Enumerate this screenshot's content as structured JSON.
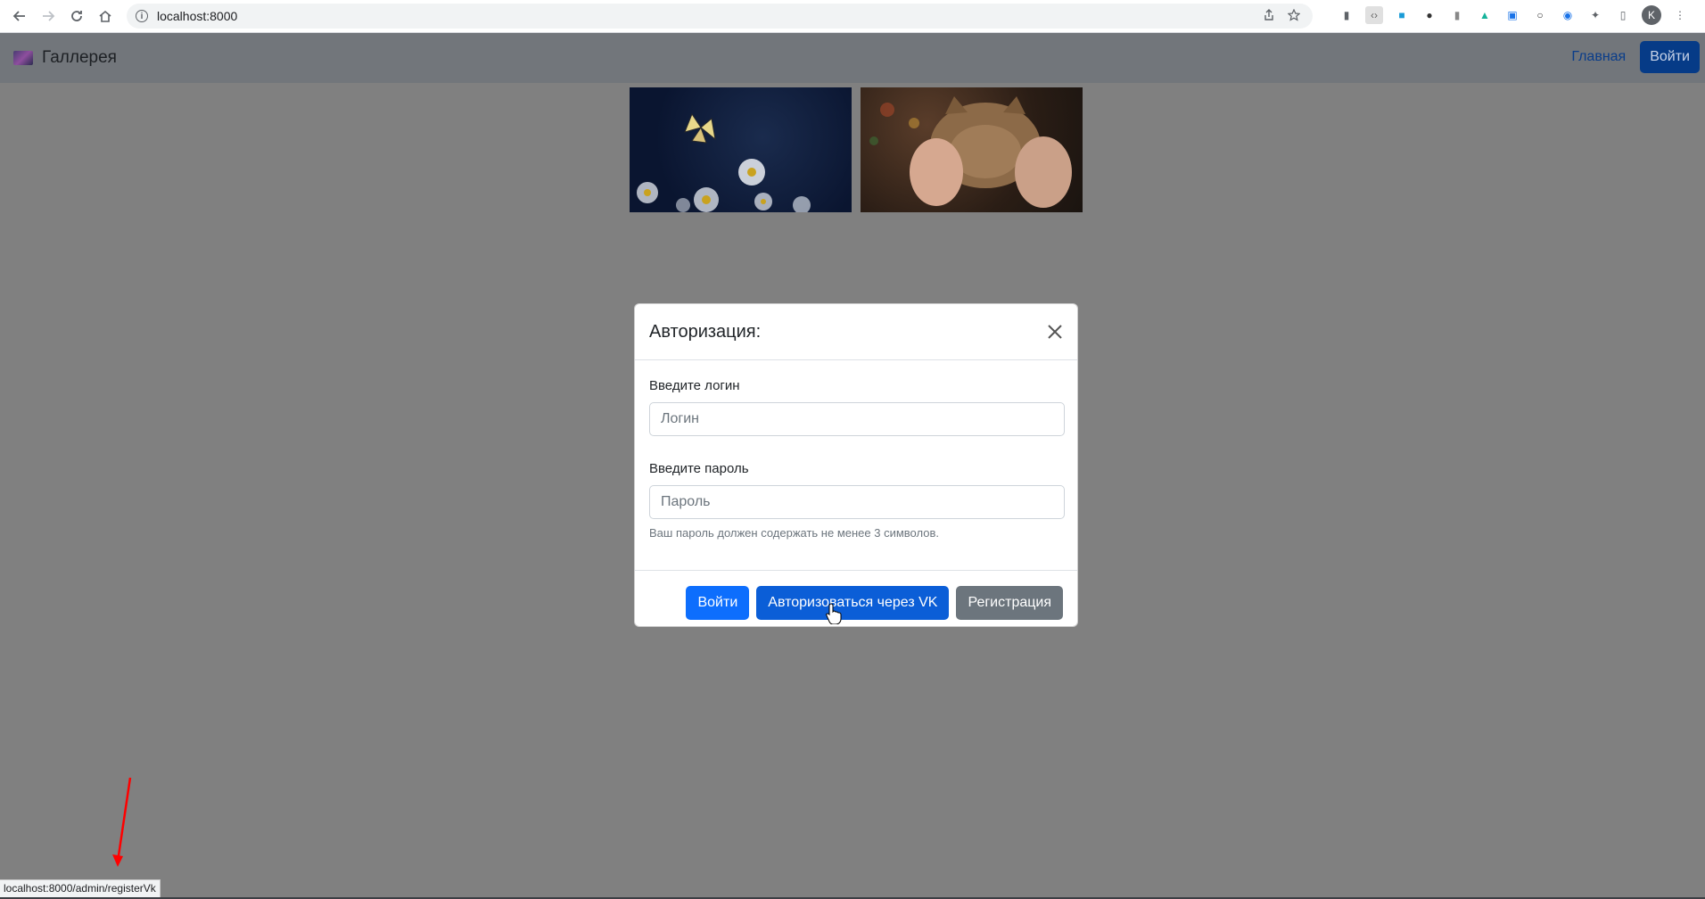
{
  "browser": {
    "url": "localhost:8000",
    "profile_initial": "K",
    "status_url": "localhost:8000/admin/registerVk"
  },
  "navbar": {
    "brand": "Галлерея",
    "home_link": "Главная",
    "login_button": "Войти"
  },
  "gallery": {
    "images": [
      "butterfly-on-daisies",
      "cat-in-hands"
    ]
  },
  "modal": {
    "title": "Авторизация:",
    "login_label": "Введите логин",
    "login_placeholder": "Логин",
    "password_label": "Введите пароль",
    "password_placeholder": "Пароль",
    "password_help": "Ваш пароль должен содержать не менее 3 символов.",
    "buttons": {
      "login": "Войти",
      "vk": "Авторизоваться через VK",
      "register": "Регистрация"
    }
  },
  "colors": {
    "primary": "#0d6efd",
    "secondary": "#6c757d",
    "backdrop": "#808080",
    "annotation_arrow": "#ff0000"
  }
}
